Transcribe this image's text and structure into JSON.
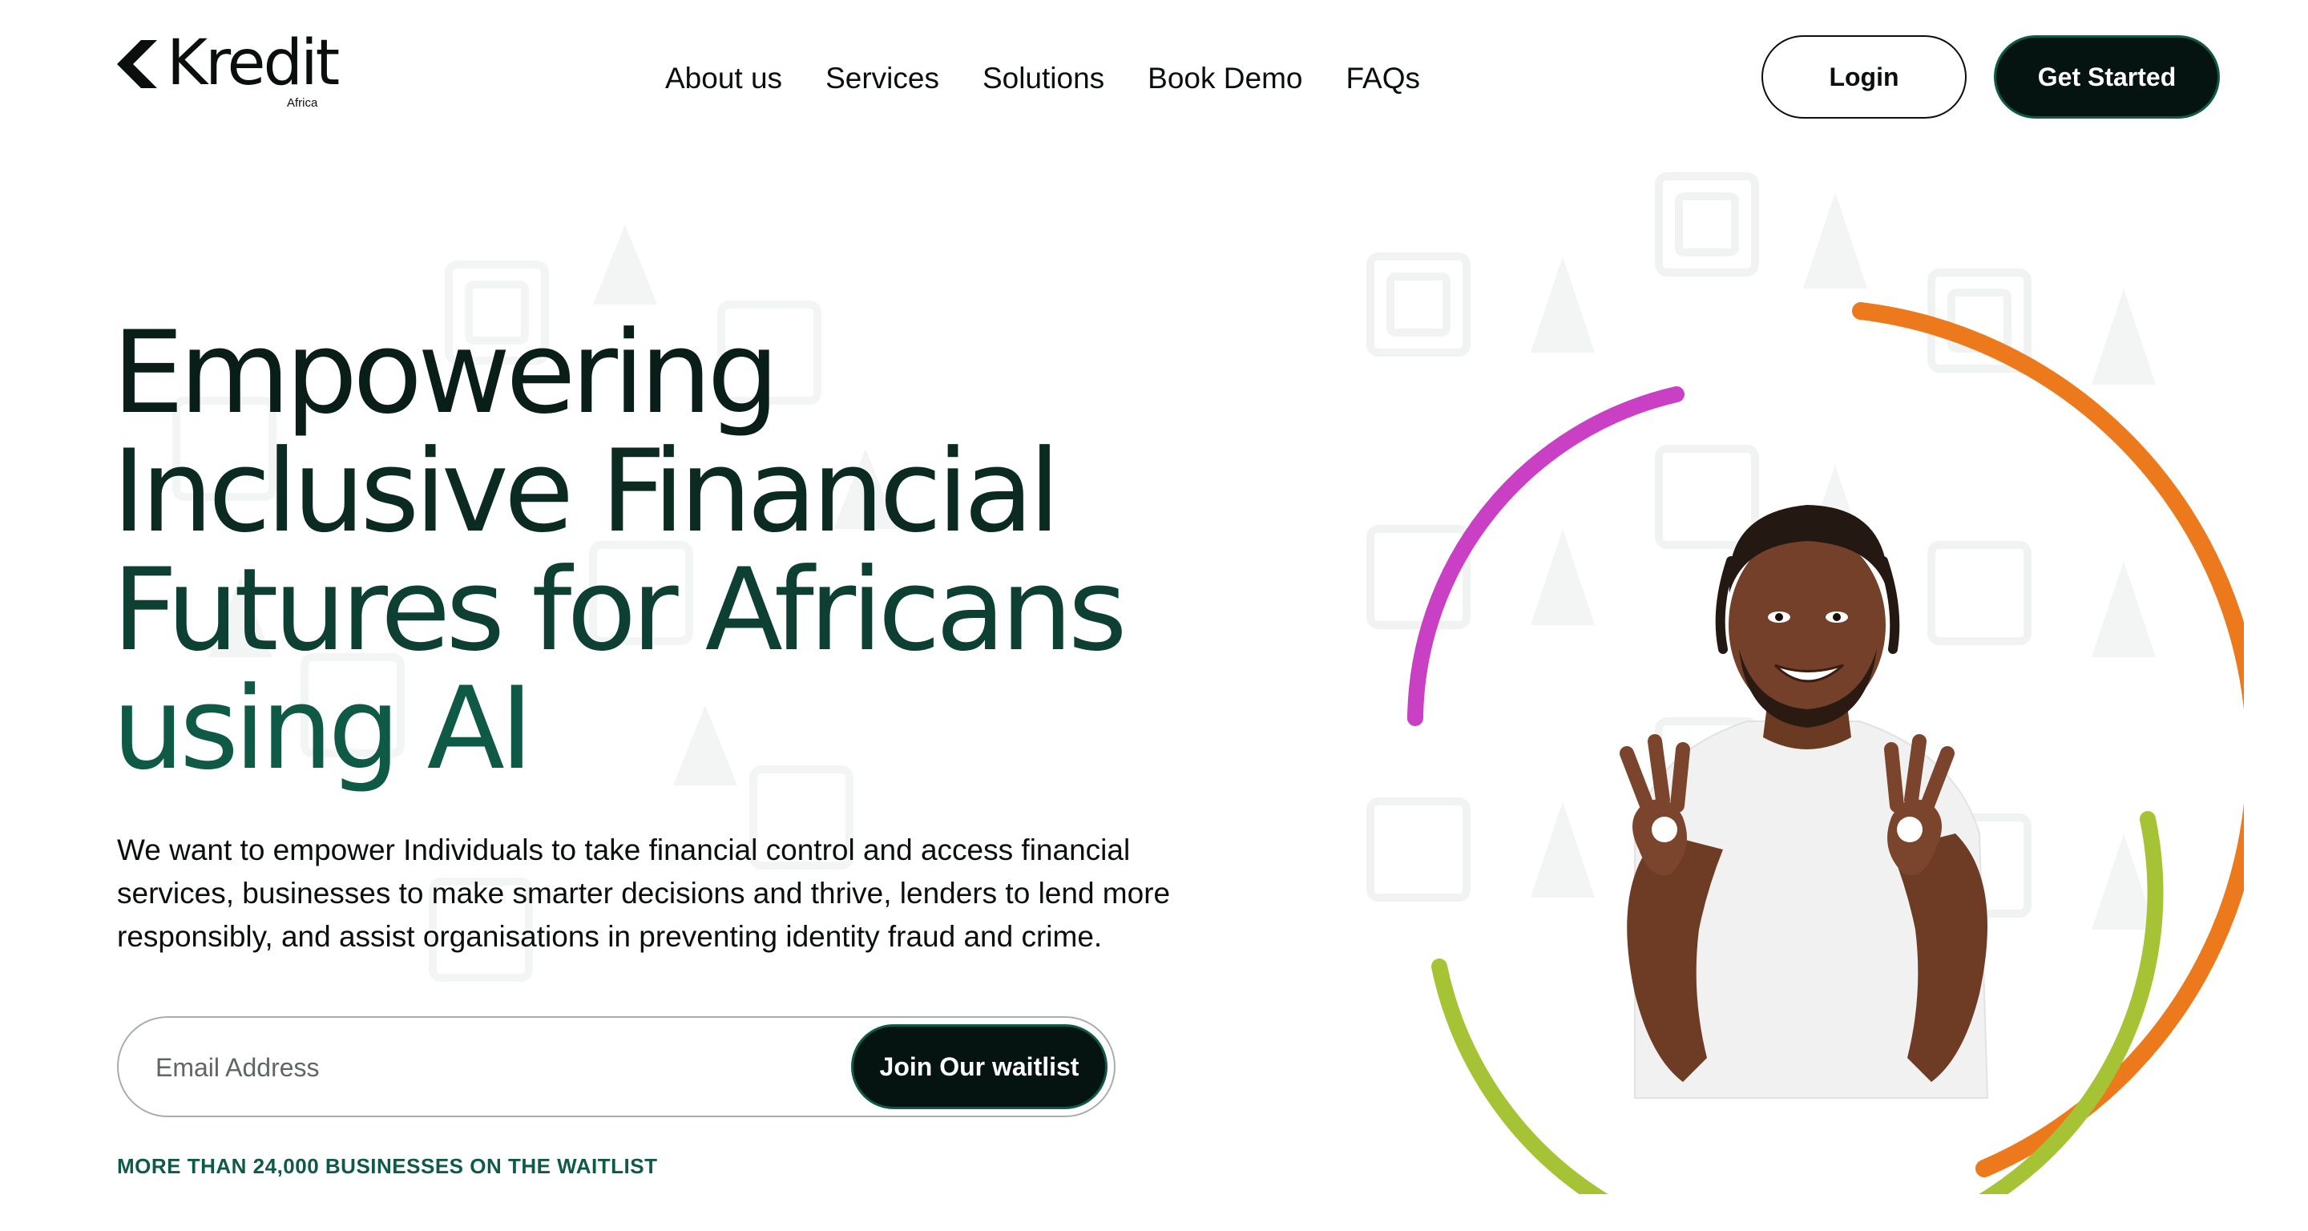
{
  "brand": {
    "name": "Kredit",
    "sub": "Africa"
  },
  "nav": {
    "items": [
      {
        "label": "About us"
      },
      {
        "label": "Services"
      },
      {
        "label": "Solutions"
      },
      {
        "label": "Book Demo"
      },
      {
        "label": "FAQs"
      }
    ],
    "login_label": "Login",
    "get_started_label": "Get Started"
  },
  "hero": {
    "headline_lines": [
      "Empowering",
      "Inclusive Financial",
      "Futures for Africans",
      "using AI"
    ],
    "lead": "We want to empower Individuals to take financial control and access financial services, businesses to make smarter decisions and thrive, lenders to lend more responsibly, and assist organisations in preventing identity fraud and crime.",
    "email_placeholder": "Email Address",
    "join_label": "Join Our waitlist",
    "waitlist_note": "MORE THAN 24,000 BUSINESSES ON THE WAITLIST"
  },
  "colors": {
    "dark": "#061411",
    "brand_green": "#0f5a46",
    "arc_orange": "#ec7a1c",
    "arc_magenta": "#c940c4",
    "arc_lime": "#a6c335"
  }
}
